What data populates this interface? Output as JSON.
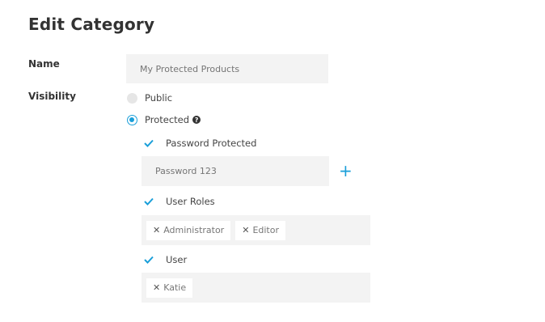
{
  "page": {
    "title": "Edit Category"
  },
  "name_field": {
    "label": "Name",
    "placeholder": "My Protected Products"
  },
  "visibility": {
    "label": "Visibility",
    "options": [
      {
        "label": "Public",
        "selected": false
      },
      {
        "label": "Protected",
        "selected": true
      }
    ],
    "help_icon": "?"
  },
  "protection": {
    "password": {
      "label": "Password Protected",
      "checked": true,
      "placeholder": "Password 123",
      "add_icon": "+"
    },
    "user_roles": {
      "label": "User Roles",
      "checked": true,
      "tags": [
        "Administrator",
        "Editor"
      ]
    },
    "user": {
      "label": "User",
      "checked": true,
      "tags": [
        "Katie"
      ]
    }
  },
  "colors": {
    "accent": "#1a9fd9",
    "input_bg": "#f3f3f3"
  },
  "icons": {
    "tag_remove": "close-icon",
    "check": "check-icon",
    "help": "question-icon",
    "add": "plus-icon"
  }
}
